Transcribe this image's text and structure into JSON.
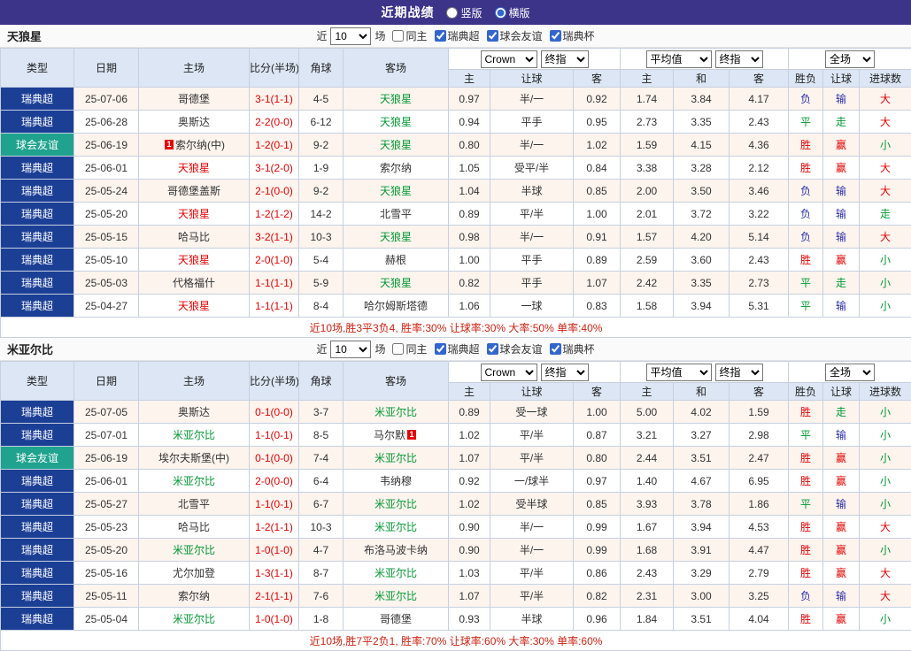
{
  "topbar": {
    "title": "近期战绩",
    "radios": {
      "vertical_label": "竖版",
      "horizontal_label": "横版",
      "vertical_checked": false,
      "horizontal_checked": true
    }
  },
  "controls": {
    "near_label": "近",
    "match_count": "10",
    "unit_label": "场",
    "checkboxes": [
      {
        "label": "同主",
        "checked": false
      },
      {
        "label": "瑞典超",
        "checked": true
      },
      {
        "label": "球会友谊",
        "checked": true
      },
      {
        "label": "瑞典杯",
        "checked": true
      }
    ]
  },
  "table_header": {
    "type": "类型",
    "date": "日期",
    "home": "主场",
    "score": "比分(半场)",
    "corner": "角球",
    "away": "客场",
    "bookmaker_select": "Crown",
    "final_select": "终指",
    "average_select": "平均值",
    "fulltime_select": "全场",
    "sub": {
      "home": "主",
      "handicap": "让球",
      "away": "客",
      "avg_home": "主",
      "avg_draw": "和",
      "avg_away": "客",
      "result": "胜负",
      "handicap_result": "让球",
      "goals": "进球数"
    }
  },
  "colors": {
    "win_red": "#e60000",
    "draw_green": "#009933",
    "loss_blue": "#2d31a8",
    "league_swedish_bg": "#1c3f96",
    "friendly_bg": "#1fa38e",
    "topbar_bg": "#3c3489",
    "odd_row_bg": "#fdf4ee",
    "header_bg": "#dce6f4"
  },
  "sections": [
    {
      "team": "天狼星",
      "summary": "近10场,胜3平3负4, 胜率:30% 让球率:30% 大率:50% 单率:40%",
      "rows": [
        {
          "lg": "瑞典超",
          "lgType": "sw",
          "date": "25-07-06",
          "home": "哥德堡",
          "homeColor": "",
          "homeCard": "",
          "score": "3-1(1-1)",
          "corner": "4-5",
          "away": "天狼星",
          "awayColor": "green",
          "awayCard": "",
          "wH": "0.97",
          "hcap": "半/一",
          "wA": "0.92",
          "aH": "1.74",
          "aD": "3.84",
          "aA": "4.17",
          "res": "负",
          "hres": "输",
          "goal": "大"
        },
        {
          "lg": "瑞典超",
          "lgType": "sw",
          "date": "25-06-28",
          "home": "奥斯达",
          "homeColor": "",
          "homeCard": "",
          "score": "2-2(0-0)",
          "corner": "6-12",
          "away": "天狼星",
          "awayColor": "green",
          "awayCard": "",
          "wH": "0.94",
          "hcap": "平手",
          "wA": "0.95",
          "aH": "2.73",
          "aD": "3.35",
          "aA": "2.43",
          "res": "平",
          "hres": "走",
          "goal": "大"
        },
        {
          "lg": "球会友谊",
          "lgType": "fr",
          "date": "25-06-19",
          "home": "索尔纳(中)",
          "homeColor": "",
          "homeCard": "1",
          "score": "1-2(0-1)",
          "corner": "9-2",
          "away": "天狼星",
          "awayColor": "green",
          "awayCard": "",
          "wH": "0.80",
          "hcap": "半/一",
          "wA": "1.02",
          "aH": "1.59",
          "aD": "4.15",
          "aA": "4.36",
          "res": "胜",
          "hres": "赢",
          "goal": "小"
        },
        {
          "lg": "瑞典超",
          "lgType": "sw",
          "date": "25-06-01",
          "home": "天狼星",
          "homeColor": "red",
          "homeCard": "",
          "score": "3-1(2-0)",
          "corner": "1-9",
          "away": "索尔纳",
          "awayColor": "",
          "awayCard": "",
          "wH": "1.05",
          "hcap": "受平/半",
          "wA": "0.84",
          "aH": "3.38",
          "aD": "3.28",
          "aA": "2.12",
          "res": "胜",
          "hres": "赢",
          "goal": "大"
        },
        {
          "lg": "瑞典超",
          "lgType": "sw",
          "date": "25-05-24",
          "home": "哥德堡盖斯",
          "homeColor": "",
          "homeCard": "",
          "score": "2-1(0-0)",
          "corner": "9-2",
          "away": "天狼星",
          "awayColor": "green",
          "awayCard": "",
          "wH": "1.04",
          "hcap": "半球",
          "wA": "0.85",
          "aH": "2.00",
          "aD": "3.50",
          "aA": "3.46",
          "res": "负",
          "hres": "输",
          "goal": "大"
        },
        {
          "lg": "瑞典超",
          "lgType": "sw",
          "date": "25-05-20",
          "home": "天狼星",
          "homeColor": "red",
          "homeCard": "",
          "score": "1-2(1-2)",
          "corner": "14-2",
          "away": "北雪平",
          "awayColor": "",
          "awayCard": "",
          "wH": "0.89",
          "hcap": "平/半",
          "wA": "1.00",
          "aH": "2.01",
          "aD": "3.72",
          "aA": "3.22",
          "res": "负",
          "hres": "输",
          "goal": "走"
        },
        {
          "lg": "瑞典超",
          "lgType": "sw",
          "date": "25-05-15",
          "home": "哈马比",
          "homeColor": "",
          "homeCard": "",
          "score": "3-2(1-1)",
          "corner": "10-3",
          "away": "天狼星",
          "awayColor": "green",
          "awayCard": "",
          "wH": "0.98",
          "hcap": "半/一",
          "wA": "0.91",
          "aH": "1.57",
          "aD": "4.20",
          "aA": "5.14",
          "res": "负",
          "hres": "输",
          "goal": "大"
        },
        {
          "lg": "瑞典超",
          "lgType": "sw",
          "date": "25-05-10",
          "home": "天狼星",
          "homeColor": "red",
          "homeCard": "",
          "score": "2-0(1-0)",
          "corner": "5-4",
          "away": "赫根",
          "awayColor": "",
          "awayCard": "",
          "wH": "1.00",
          "hcap": "平手",
          "wA": "0.89",
          "aH": "2.59",
          "aD": "3.60",
          "aA": "2.43",
          "res": "胜",
          "hres": "赢",
          "goal": "小"
        },
        {
          "lg": "瑞典超",
          "lgType": "sw",
          "date": "25-05-03",
          "home": "代格福什",
          "homeColor": "",
          "homeCard": "",
          "score": "1-1(1-1)",
          "corner": "5-9",
          "away": "天狼星",
          "awayColor": "green",
          "awayCard": "",
          "wH": "0.82",
          "hcap": "平手",
          "wA": "1.07",
          "aH": "2.42",
          "aD": "3.35",
          "aA": "2.73",
          "res": "平",
          "hres": "走",
          "goal": "小"
        },
        {
          "lg": "瑞典超",
          "lgType": "sw",
          "date": "25-04-27",
          "home": "天狼星",
          "homeColor": "red",
          "homeCard": "",
          "score": "1-1(1-1)",
          "corner": "8-4",
          "away": "哈尔姆斯塔德",
          "awayColor": "",
          "awayCard": "",
          "wH": "1.06",
          "hcap": "一球",
          "wA": "0.83",
          "aH": "1.58",
          "aD": "3.94",
          "aA": "5.31",
          "res": "平",
          "hres": "输",
          "goal": "小"
        }
      ]
    },
    {
      "team": "米亚尔比",
      "summary": "近10场,胜7平2负1, 胜率:70% 让球率:60% 大率:30% 单率:60%",
      "rows": [
        {
          "lg": "瑞典超",
          "lgType": "sw",
          "date": "25-07-05",
          "home": "奥斯达",
          "homeColor": "",
          "homeCard": "",
          "score": "0-1(0-0)",
          "corner": "3-7",
          "away": "米亚尔比",
          "awayColor": "green",
          "awayCard": "",
          "wH": "0.89",
          "hcap": "受一球",
          "wA": "1.00",
          "aH": "5.00",
          "aD": "4.02",
          "aA": "1.59",
          "res": "胜",
          "hres": "走",
          "goal": "小"
        },
        {
          "lg": "瑞典超",
          "lgType": "sw",
          "date": "25-07-01",
          "home": "米亚尔比",
          "homeColor": "green",
          "homeCard": "",
          "score": "1-1(0-1)",
          "corner": "8-5",
          "away": "马尔默",
          "awayColor": "",
          "awayCard": "1",
          "wH": "1.02",
          "hcap": "平/半",
          "wA": "0.87",
          "aH": "3.21",
          "aD": "3.27",
          "aA": "2.98",
          "res": "平",
          "hres": "输",
          "goal": "小"
        },
        {
          "lg": "球会友谊",
          "lgType": "fr",
          "date": "25-06-19",
          "home": "埃尔夫斯堡(中)",
          "homeColor": "",
          "homeCard": "",
          "score": "0-1(0-0)",
          "corner": "7-4",
          "away": "米亚尔比",
          "awayColor": "green",
          "awayCard": "",
          "wH": "1.07",
          "hcap": "平/半",
          "wA": "0.80",
          "aH": "2.44",
          "aD": "3.51",
          "aA": "2.47",
          "res": "胜",
          "hres": "赢",
          "goal": "小"
        },
        {
          "lg": "瑞典超",
          "lgType": "sw",
          "date": "25-06-01",
          "home": "米亚尔比",
          "homeColor": "green",
          "homeCard": "",
          "score": "2-0(0-0)",
          "corner": "6-4",
          "away": "韦纳穆",
          "awayColor": "",
          "awayCard": "",
          "wH": "0.92",
          "hcap": "一/球半",
          "wA": "0.97",
          "aH": "1.40",
          "aD": "4.67",
          "aA": "6.95",
          "res": "胜",
          "hres": "赢",
          "goal": "小"
        },
        {
          "lg": "瑞典超",
          "lgType": "sw",
          "date": "25-05-27",
          "home": "北雪平",
          "homeColor": "",
          "homeCard": "",
          "score": "1-1(0-1)",
          "corner": "6-7",
          "away": "米亚尔比",
          "awayColor": "green",
          "awayCard": "",
          "wH": "1.02",
          "hcap": "受半球",
          "wA": "0.85",
          "aH": "3.93",
          "aD": "3.78",
          "aA": "1.86",
          "res": "平",
          "hres": "输",
          "goal": "小"
        },
        {
          "lg": "瑞典超",
          "lgType": "sw",
          "date": "25-05-23",
          "home": "哈马比",
          "homeColor": "",
          "homeCard": "",
          "score": "1-2(1-1)",
          "corner": "10-3",
          "away": "米亚尔比",
          "awayColor": "green",
          "awayCard": "",
          "wH": "0.90",
          "hcap": "半/一",
          "wA": "0.99",
          "aH": "1.67",
          "aD": "3.94",
          "aA": "4.53",
          "res": "胜",
          "hres": "赢",
          "goal": "大"
        },
        {
          "lg": "瑞典超",
          "lgType": "sw",
          "date": "25-05-20",
          "home": "米亚尔比",
          "homeColor": "green",
          "homeCard": "",
          "score": "1-0(1-0)",
          "corner": "4-7",
          "away": "布洛马波卡纳",
          "awayColor": "",
          "awayCard": "",
          "wH": "0.90",
          "hcap": "半/一",
          "wA": "0.99",
          "aH": "1.68",
          "aD": "3.91",
          "aA": "4.47",
          "res": "胜",
          "hres": "赢",
          "goal": "小"
        },
        {
          "lg": "瑞典超",
          "lgType": "sw",
          "date": "25-05-16",
          "home": "尤尔加登",
          "homeColor": "",
          "homeCard": "",
          "score": "1-3(1-1)",
          "corner": "8-7",
          "away": "米亚尔比",
          "awayColor": "green",
          "awayCard": "",
          "wH": "1.03",
          "hcap": "平/半",
          "wA": "0.86",
          "aH": "2.43",
          "aD": "3.29",
          "aA": "2.79",
          "res": "胜",
          "hres": "赢",
          "goal": "大"
        },
        {
          "lg": "瑞典超",
          "lgType": "sw",
          "date": "25-05-11",
          "home": "索尔纳",
          "homeColor": "",
          "homeCard": "",
          "score": "2-1(1-1)",
          "corner": "7-6",
          "away": "米亚尔比",
          "awayColor": "green",
          "awayCard": "",
          "wH": "1.07",
          "hcap": "平/半",
          "wA": "0.82",
          "aH": "2.31",
          "aD": "3.00",
          "aA": "3.25",
          "res": "负",
          "hres": "输",
          "goal": "大"
        },
        {
          "lg": "瑞典超",
          "lgType": "sw",
          "date": "25-05-04",
          "home": "米亚尔比",
          "homeColor": "green",
          "homeCard": "",
          "score": "1-0(1-0)",
          "corner": "1-8",
          "away": "哥德堡",
          "awayColor": "",
          "awayCard": "",
          "wH": "0.93",
          "hcap": "半球",
          "wA": "0.96",
          "aH": "1.84",
          "aD": "3.51",
          "aA": "4.04",
          "res": "胜",
          "hres": "赢",
          "goal": "小"
        }
      ]
    }
  ]
}
